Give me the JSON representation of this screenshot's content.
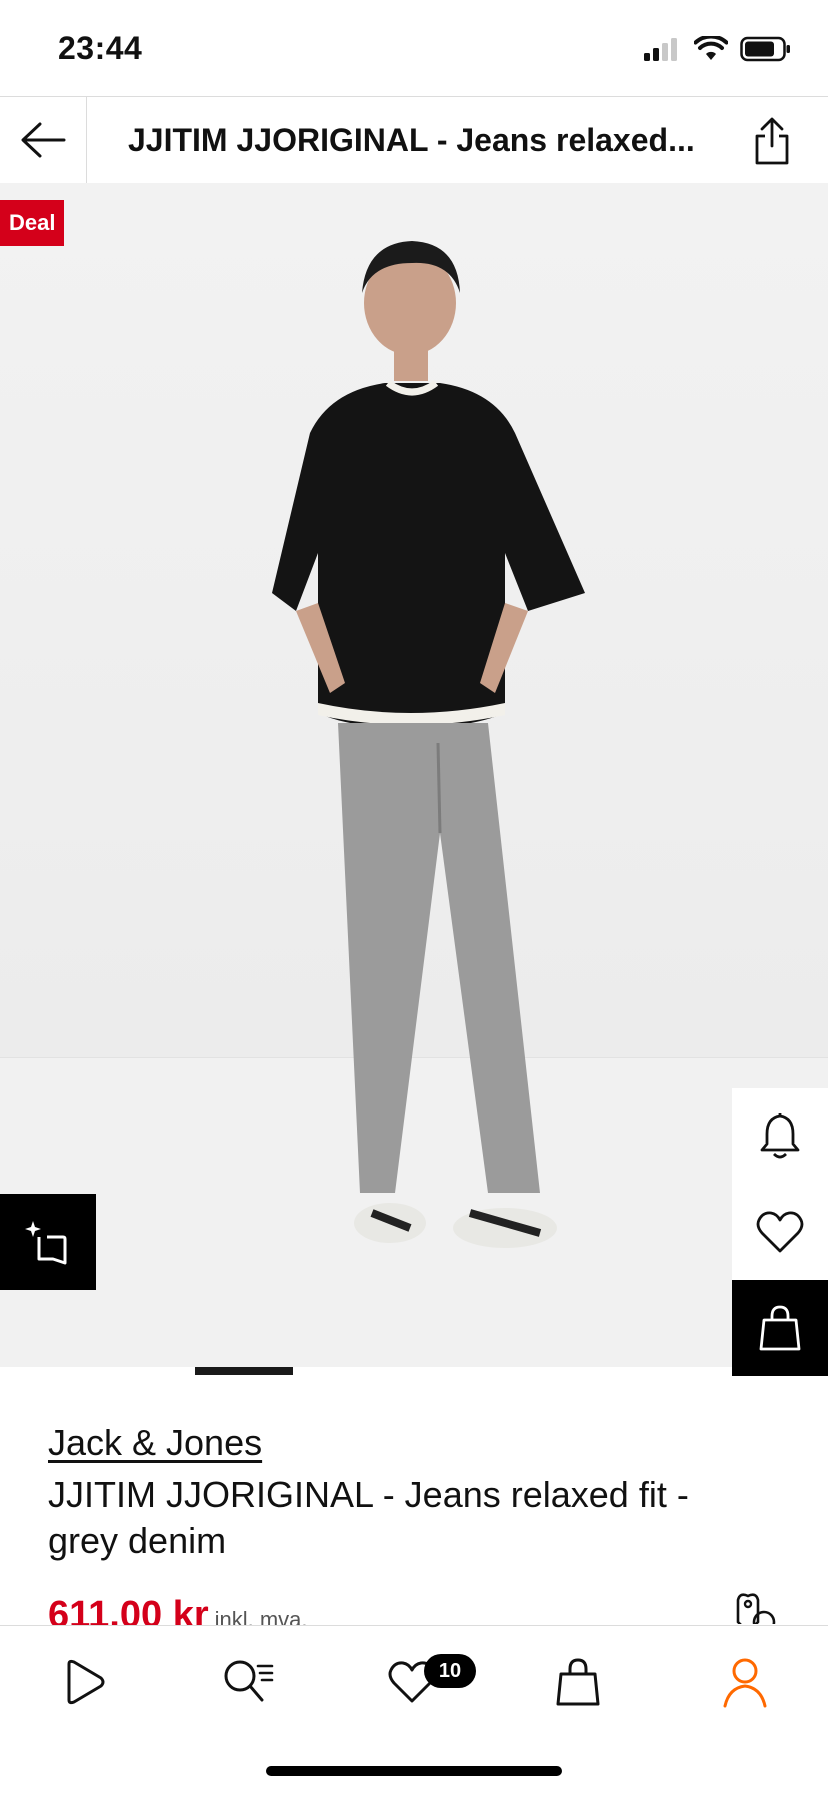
{
  "status_bar": {
    "time": "23:44"
  },
  "nav": {
    "title": "JJITIM JJORIGINAL - Jeans relaxed..."
  },
  "product": {
    "badge": "Deal",
    "brand": "Jack & Jones",
    "name": "JJITIM JJORIGINAL - Jeans relaxed fit - grey denim",
    "price": "611,00 kr",
    "vat_note": "inkl. mva."
  },
  "tabbar": {
    "wishlist_count": "10"
  },
  "colors": {
    "accent": "#d4001a",
    "profile_active": "#ff6900",
    "text": "#1a1a1a"
  },
  "icons": [
    "back-arrow-icon",
    "share-icon",
    "visual-search-icon",
    "bell-icon",
    "heart-icon",
    "bag-icon",
    "tag-icon",
    "play-icon",
    "search-icon",
    "wishlist-icon",
    "cart-icon",
    "profile-icon"
  ]
}
